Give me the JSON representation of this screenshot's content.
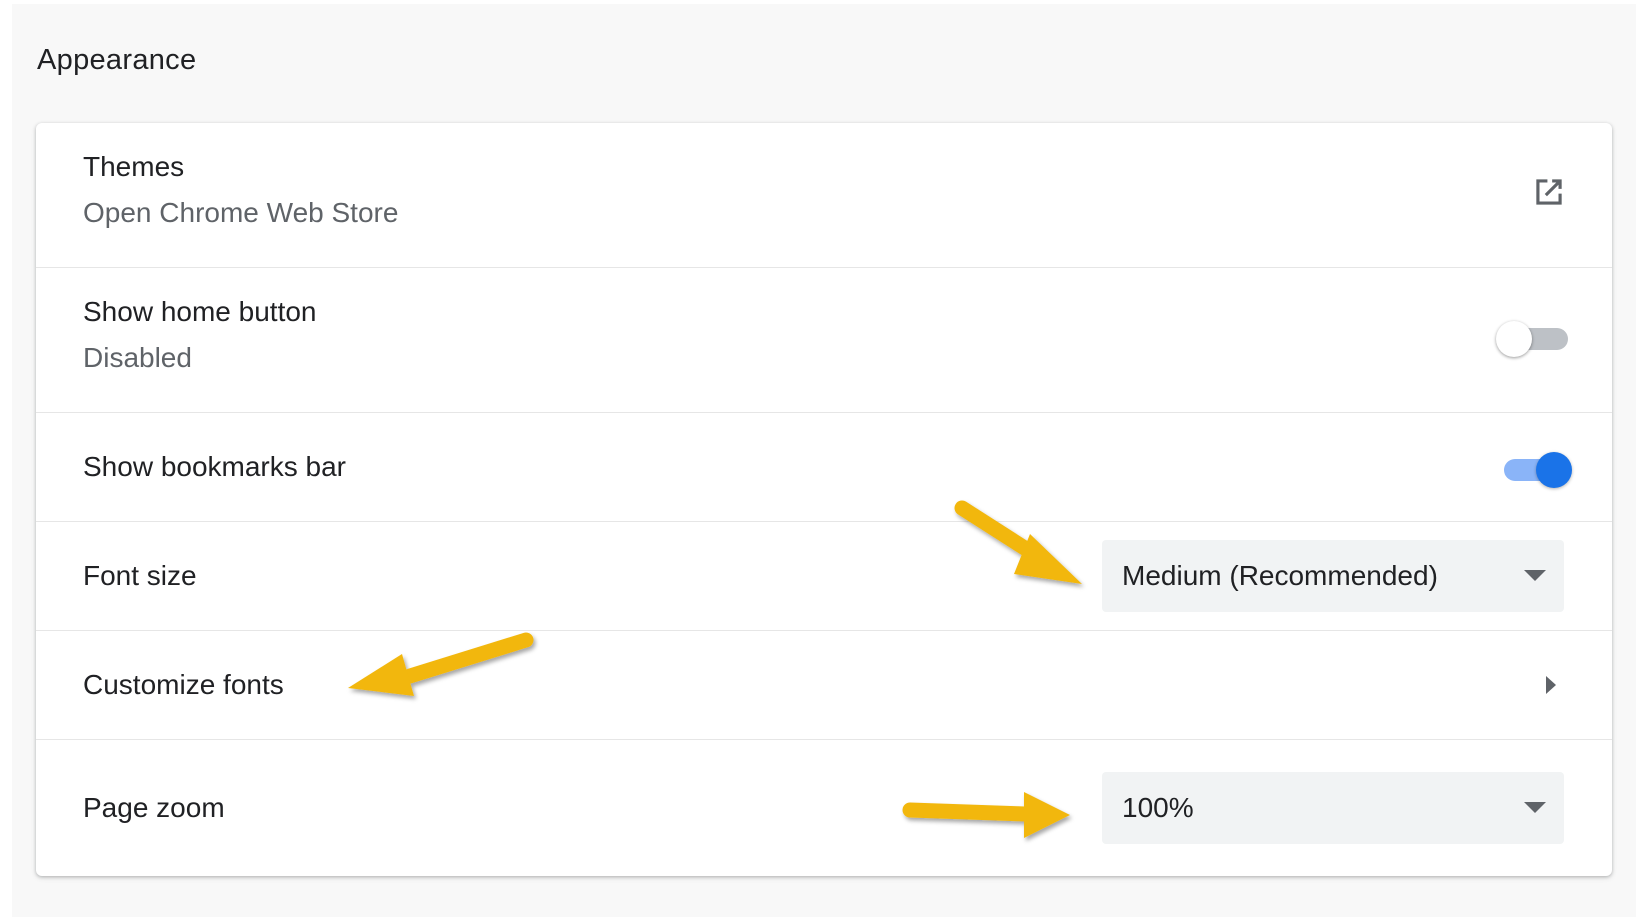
{
  "section": {
    "title": "Appearance"
  },
  "rows": {
    "themes": {
      "label": "Themes",
      "sublabel": "Open Chrome Web Store",
      "icon": "external-link-icon"
    },
    "home_button": {
      "label": "Show home button",
      "sublabel": "Disabled",
      "toggle_on": false
    },
    "bookmarks_bar": {
      "label": "Show bookmarks bar",
      "toggle_on": true
    },
    "font_size": {
      "label": "Font size",
      "value": "Medium (Recommended)",
      "icon": "chevron-down-icon"
    },
    "customize_fonts": {
      "label": "Customize fonts",
      "icon": "chevron-right-icon"
    },
    "page_zoom": {
      "label": "Page zoom",
      "value": "100%",
      "icon": "chevron-down-icon"
    }
  },
  "colors": {
    "accent": "#1a73e8",
    "accent_track": "#8ab4f8",
    "annotation_arrow": "#f2b70e",
    "text_primary": "#202124",
    "text_secondary": "#5f6368"
  }
}
